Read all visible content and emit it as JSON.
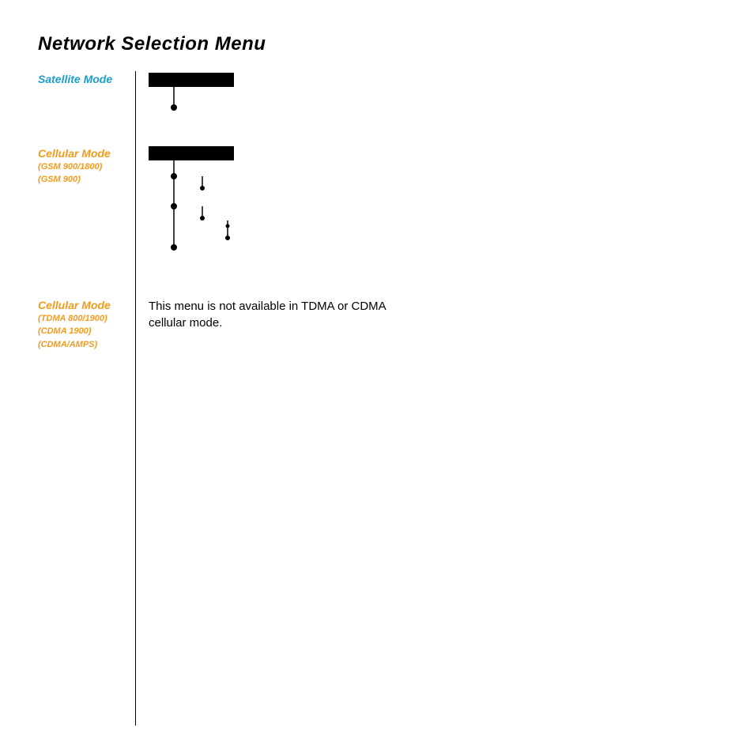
{
  "title": "Network Selection Menu",
  "sections": {
    "satellite": {
      "label": "Satellite Mode"
    },
    "cellular_gsm": {
      "label": "Cellular Mode",
      "sub1": "(GSM 900/1800)",
      "sub2": "(GSM 900)"
    },
    "cellular_tdma": {
      "label": "Cellular Mode",
      "sub1": "(TDMA 800/1900)",
      "sub2": "(CDMA 1900)",
      "sub3": "(CDMA/AMPS)"
    }
  },
  "body_text": "This menu is not available in TDMA or CDMA cellular mode."
}
